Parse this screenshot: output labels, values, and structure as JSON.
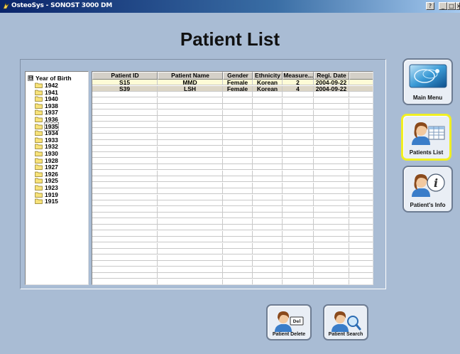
{
  "window": {
    "title": "OsteoSys - SONOST 3000 DM",
    "controls": {
      "help": "?",
      "minimize": "_",
      "maximize": "□",
      "close": "×"
    }
  },
  "page": {
    "title": "Patient List"
  },
  "tree": {
    "root_label": "Year of Birth",
    "expander": "⊟",
    "years": [
      "1942",
      "1941",
      "1940",
      "1938",
      "1937",
      "1936",
      "1935",
      "1934",
      "1933",
      "1932",
      "1930",
      "1928",
      "1927",
      "1926",
      "1925",
      "1923",
      "1919",
      "1915"
    ],
    "selected": "1935"
  },
  "table": {
    "columns": [
      "Patient ID",
      "Patient Name",
      "Gender",
      "Ethnicity",
      "Measure...",
      "Regi. Date"
    ],
    "rows": [
      [
        "S15",
        "MMD",
        "Female",
        "Korean",
        "2",
        "2004-09-22"
      ],
      [
        "S39",
        "LSH",
        "Female",
        "Korean",
        "4",
        "2004-09-22"
      ]
    ]
  },
  "sidebar": {
    "items": [
      {
        "label": "Main Menu",
        "icon": "main-menu-icon",
        "active": false
      },
      {
        "label": "Patients List",
        "icon": "patients-list-icon",
        "active": true
      },
      {
        "label": "Patient's Info",
        "icon": "patient-info-icon",
        "active": false
      }
    ]
  },
  "actions": {
    "delete_label": "Patient Delete",
    "search_label": "Patient Search"
  },
  "colors": {
    "background": "#a9bcd4",
    "active_border": "#f0ef22",
    "row_primary": "#fdfbd6",
    "row_secondary": "#dcd6c6",
    "titlebar": "#0a246a"
  }
}
